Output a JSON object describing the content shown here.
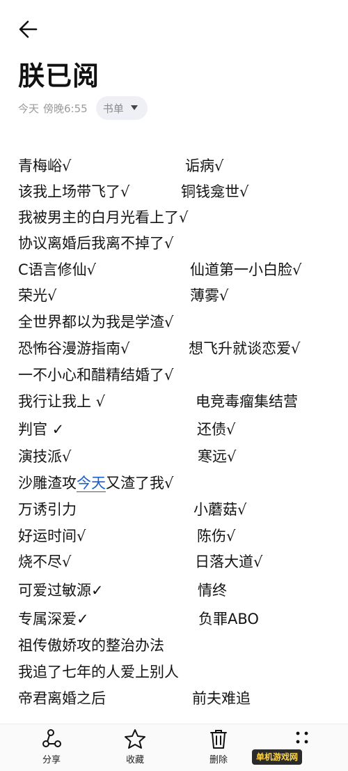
{
  "header": {
    "back_icon": "arrow-left-icon",
    "title": "朕已阅",
    "date_label": "今天",
    "time_label": "傍晚6:55",
    "folder_chip": {
      "label": "书单",
      "icon": "caret-down-icon"
    }
  },
  "note": {
    "rows": [
      {
        "left": "青梅峪√",
        "right": "诟病√"
      },
      {
        "left": "该我上场带飞了√",
        "right": "铜钱龛世√"
      },
      {
        "left": "我被男主的白月光看上了√",
        "right": ""
      },
      {
        "left": "协议离婚后我离不掉了√",
        "right": ""
      },
      {
        "left": "C语言修仙√",
        "right": "仙道第一小白脸√"
      },
      {
        "left": "荣光√",
        "right": "薄雾√"
      },
      {
        "left": "全世界都以为我是学渣√",
        "right": ""
      },
      {
        "left": "恐怖谷漫游指南√",
        "right": "想飞升就谈恋爱√"
      },
      {
        "left": "一不小心和醋精结婚了√",
        "right": ""
      },
      {
        "left": "我行让我上 √",
        "right": "电竞毒瘤集结营"
      },
      {
        "left": "判官 ✓",
        "right": "还债√"
      },
      {
        "left": "演技派√",
        "right": "寒远√"
      },
      {
        "left_before": "沙雕渣攻",
        "left_link": "今天",
        "left_after": "又渣了我√",
        "right": ""
      },
      {
        "left": "万诱引力",
        "right": "小蘑菇√"
      },
      {
        "left": "好运时间√",
        "right": "陈伤√"
      },
      {
        "left": "烧不尽√",
        "right": "日落大道√"
      },
      {
        "left": "可爱过敏源✓",
        "right": "情终"
      },
      {
        "left": "专属深爱✓",
        "right": "负罪ABO"
      },
      {
        "left": "祖传傲娇攻的整治办法",
        "right": ""
      },
      {
        "left": "我追了七年的人爱上别人",
        "right": ""
      },
      {
        "left": "帝君离婚之后",
        "right": "前夫难追"
      }
    ]
  },
  "bottom_nav": [
    {
      "label": "分享",
      "icon": "share-icon"
    },
    {
      "label": "收藏",
      "icon": "star-icon"
    },
    {
      "label": "删除",
      "icon": "trash-icon"
    },
    {
      "label": "",
      "icon": "more-icon"
    }
  ],
  "watermark": {
    "badge": "单机游戏网"
  },
  "colors": {
    "link": "#1a5fc7",
    "chip_bg": "#eef0f6",
    "text": "#141414",
    "meta": "#9a9a9a"
  }
}
